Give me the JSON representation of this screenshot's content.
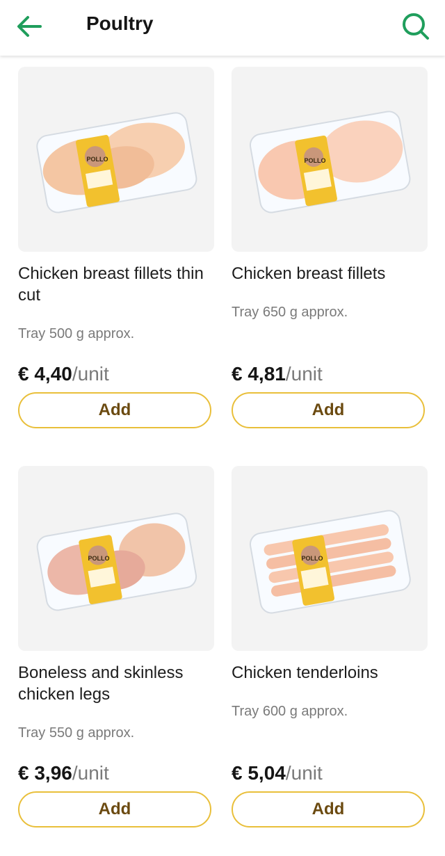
{
  "header": {
    "title": "Poultry",
    "back_icon": "arrow-left-icon",
    "search_icon": "search-icon",
    "accent_color": "#1f9e5c"
  },
  "products": [
    {
      "name": "Chicken breast fillets thin cut",
      "weight": "Tray 500 g approx.",
      "price": "€ 4,40",
      "unit": "/unit",
      "add_label": "Add"
    },
    {
      "name": "Chicken breast fillets",
      "weight": "Tray 650 g approx.",
      "price": "€ 4,81",
      "unit": "/unit",
      "add_label": "Add"
    },
    {
      "name": "Boneless and skinless chicken legs",
      "weight": "Tray 550 g approx.",
      "price": "€ 3,96",
      "unit": "/unit",
      "add_label": "Add"
    },
    {
      "name": "Chicken tenderloins",
      "weight": "Tray 600 g approx.",
      "price": "€ 5,04",
      "unit": "/unit",
      "add_label": "Add"
    }
  ],
  "package_label": "POLLO",
  "button_border_color": "#e9bf3a"
}
